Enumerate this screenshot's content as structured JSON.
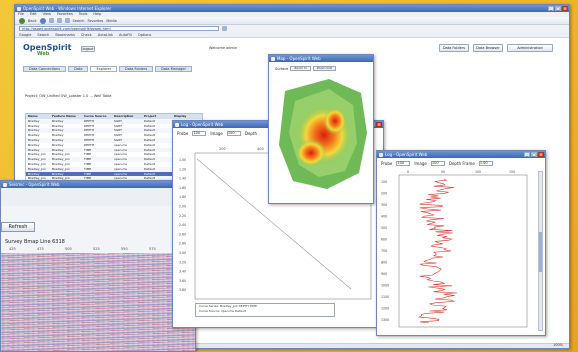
{
  "browser": {
    "title": "OpenSpirit Web - Windows Internet Explorer",
    "menus": [
      "File",
      "Edit",
      "View",
      "Favorites",
      "Tools",
      "Help"
    ],
    "toolbar": [
      "Back",
      "Search",
      "Favorites",
      "Media"
    ],
    "address": "http://osgwt.openspirit.com/openspirit/osweb.html",
    "links": [
      "Google",
      "Search",
      "Bookmarks",
      "Check",
      "AutoLink",
      "AutoFill",
      "Options"
    ],
    "zoom": "100%"
  },
  "app": {
    "logo_main": "OpenSpirit",
    "logo_sub": "Web",
    "logout": "logout",
    "welcome": "Welcome admin",
    "buttons": [
      "Data Folders",
      "Data Browser",
      "Administration"
    ],
    "tabs": [
      "Data Connections",
      "Data",
      "Explorer",
      "Data Folders",
      "Data Manager"
    ],
    "project_line": "Project: OW_Unified OW_Lobster 1.0 ... Well Table",
    "columns": [
      "Name",
      "Feature Name",
      "Curve Source",
      "Description",
      "Project",
      "Display"
    ],
    "rows": [
      [
        "Bradley",
        "Bradley",
        "DEPTH",
        "SGRT",
        "Default",
        "TRUE"
      ],
      [
        "Bradley",
        "Bradley",
        "DEPTH",
        "SGRT",
        "Default",
        "TRUE"
      ],
      [
        "Bradley",
        "Bradley",
        "DEPTH",
        "SGRT",
        "Default",
        "TRUE"
      ],
      [
        "Bradley",
        "Bradley",
        "DEPTH",
        "SGRT",
        "Default",
        "TRUE"
      ],
      [
        "Bradley",
        "Bradley",
        "DEPTH",
        "SGRT",
        "Default",
        "TRUE"
      ],
      [
        "Bradley",
        "Bradley",
        "DEPTH",
        "open.ms",
        "Default",
        "TRUE"
      ],
      [
        "Bradley",
        "Bradley",
        "TIME",
        "open.ms",
        "Default",
        "TRUE"
      ],
      [
        "Bradley_pin",
        "Bradley_pin",
        "TIME",
        "open.ms",
        "Default",
        "TRUE"
      ],
      [
        "Bradley_pin",
        "Bradley_pin",
        "TIME",
        "open.ms",
        "Default",
        "TRUE"
      ],
      [
        "Bradley_pin",
        "Bradley_pin",
        "TIME",
        "open.ms",
        "Default",
        "TRUE"
      ],
      [
        "Bradley_pin",
        "Bradley_pin",
        "TIME",
        "open.ms",
        "Default",
        "TRUE"
      ],
      [
        "Bradley",
        "Bradley",
        "TIME",
        "open.ms",
        "Default",
        "TRUE"
      ],
      [
        "Bradley_pin",
        "Bradley_pin",
        "TIME",
        "open.ms",
        "Default",
        "TRUE"
      ],
      [
        "Bradley",
        "Bradley",
        "TIME",
        "open.ms",
        "Default",
        "TRUE"
      ]
    ]
  },
  "seismic": {
    "window_title": "Seismic - OpenSpirit Web",
    "refresh": "Refresh",
    "title": "Survey Bmap Line 6318",
    "ticks": [
      "425",
      "475",
      "500",
      "525",
      "550",
      "575"
    ]
  },
  "mapwin": {
    "title": "Map - OpenSpirit Web",
    "label": "Surface",
    "btn1": "Zoom In",
    "btn2": "Zoom Out"
  },
  "plotwin": {
    "title": "Log - OpenSpirit Web",
    "probe_label": "Probe",
    "probe_value": "100",
    "image_label": "Image",
    "image_value": "100",
    "depth_label": "Depth",
    "xticks": [
      "200",
      "400",
      "600",
      "800"
    ],
    "yticks": [
      "1.00",
      "1.20",
      "1.40",
      "1.60",
      "1.80",
      "2.00",
      "2.20",
      "2.40",
      "2.60",
      "2.80",
      "3.00",
      "3.20",
      "3.40",
      "3.60",
      "3.80"
    ],
    "legend_1": "Curve Series: Bradley_pin DEPTH TIME",
    "legend_2": "Curve Source: open.ms Default"
  },
  "logwin": {
    "title": "Log - OpenSpirit Web",
    "probe_label": "Probe",
    "probe_value": "100",
    "image_label": "Image",
    "image_value": "100",
    "depth_label": "Depth Frame",
    "depth_value": "1.00",
    "xticks": [
      "0",
      "50",
      "100",
      "150"
    ],
    "yticks": [
      "100",
      "200",
      "300",
      "400",
      "500",
      "600",
      "700",
      "800",
      "900",
      "1000",
      "1100",
      "1200",
      "1300"
    ]
  }
}
